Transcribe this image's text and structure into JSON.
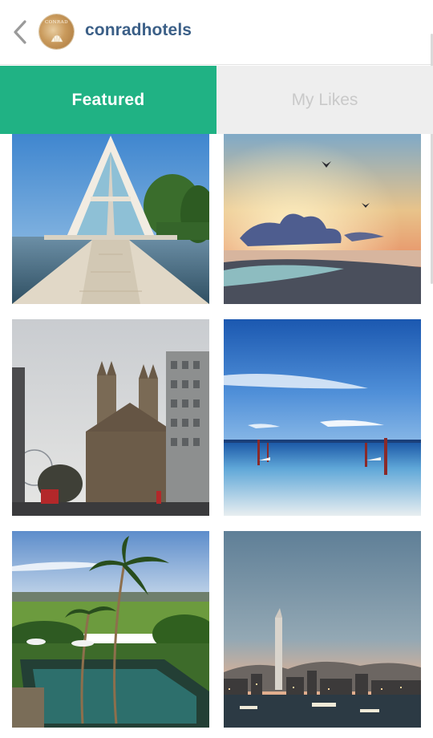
{
  "header": {
    "username": "conradhotels",
    "avatar_wordmark": "CONRAD",
    "back_icon": "chevron-left-icon"
  },
  "tabs": [
    {
      "label": "Featured",
      "active": true
    },
    {
      "label": "My Likes",
      "active": false
    }
  ],
  "photos": [
    {
      "subject": "glass chapel over water with boardwalk"
    },
    {
      "subject": "sunset sky over beach with birds"
    },
    {
      "subject": "gothic abbey beside modern building"
    },
    {
      "subject": "blue sky over shallow sea with posts"
    },
    {
      "subject": "palm trees above resort pool"
    },
    {
      "subject": "harbour city skyline at dusk"
    }
  ],
  "colors": {
    "accent": "#20b284",
    "username": "#3b5f87",
    "tab_inactive_bg": "#eeeeee",
    "tab_inactive_text": "#c9c9c9"
  }
}
